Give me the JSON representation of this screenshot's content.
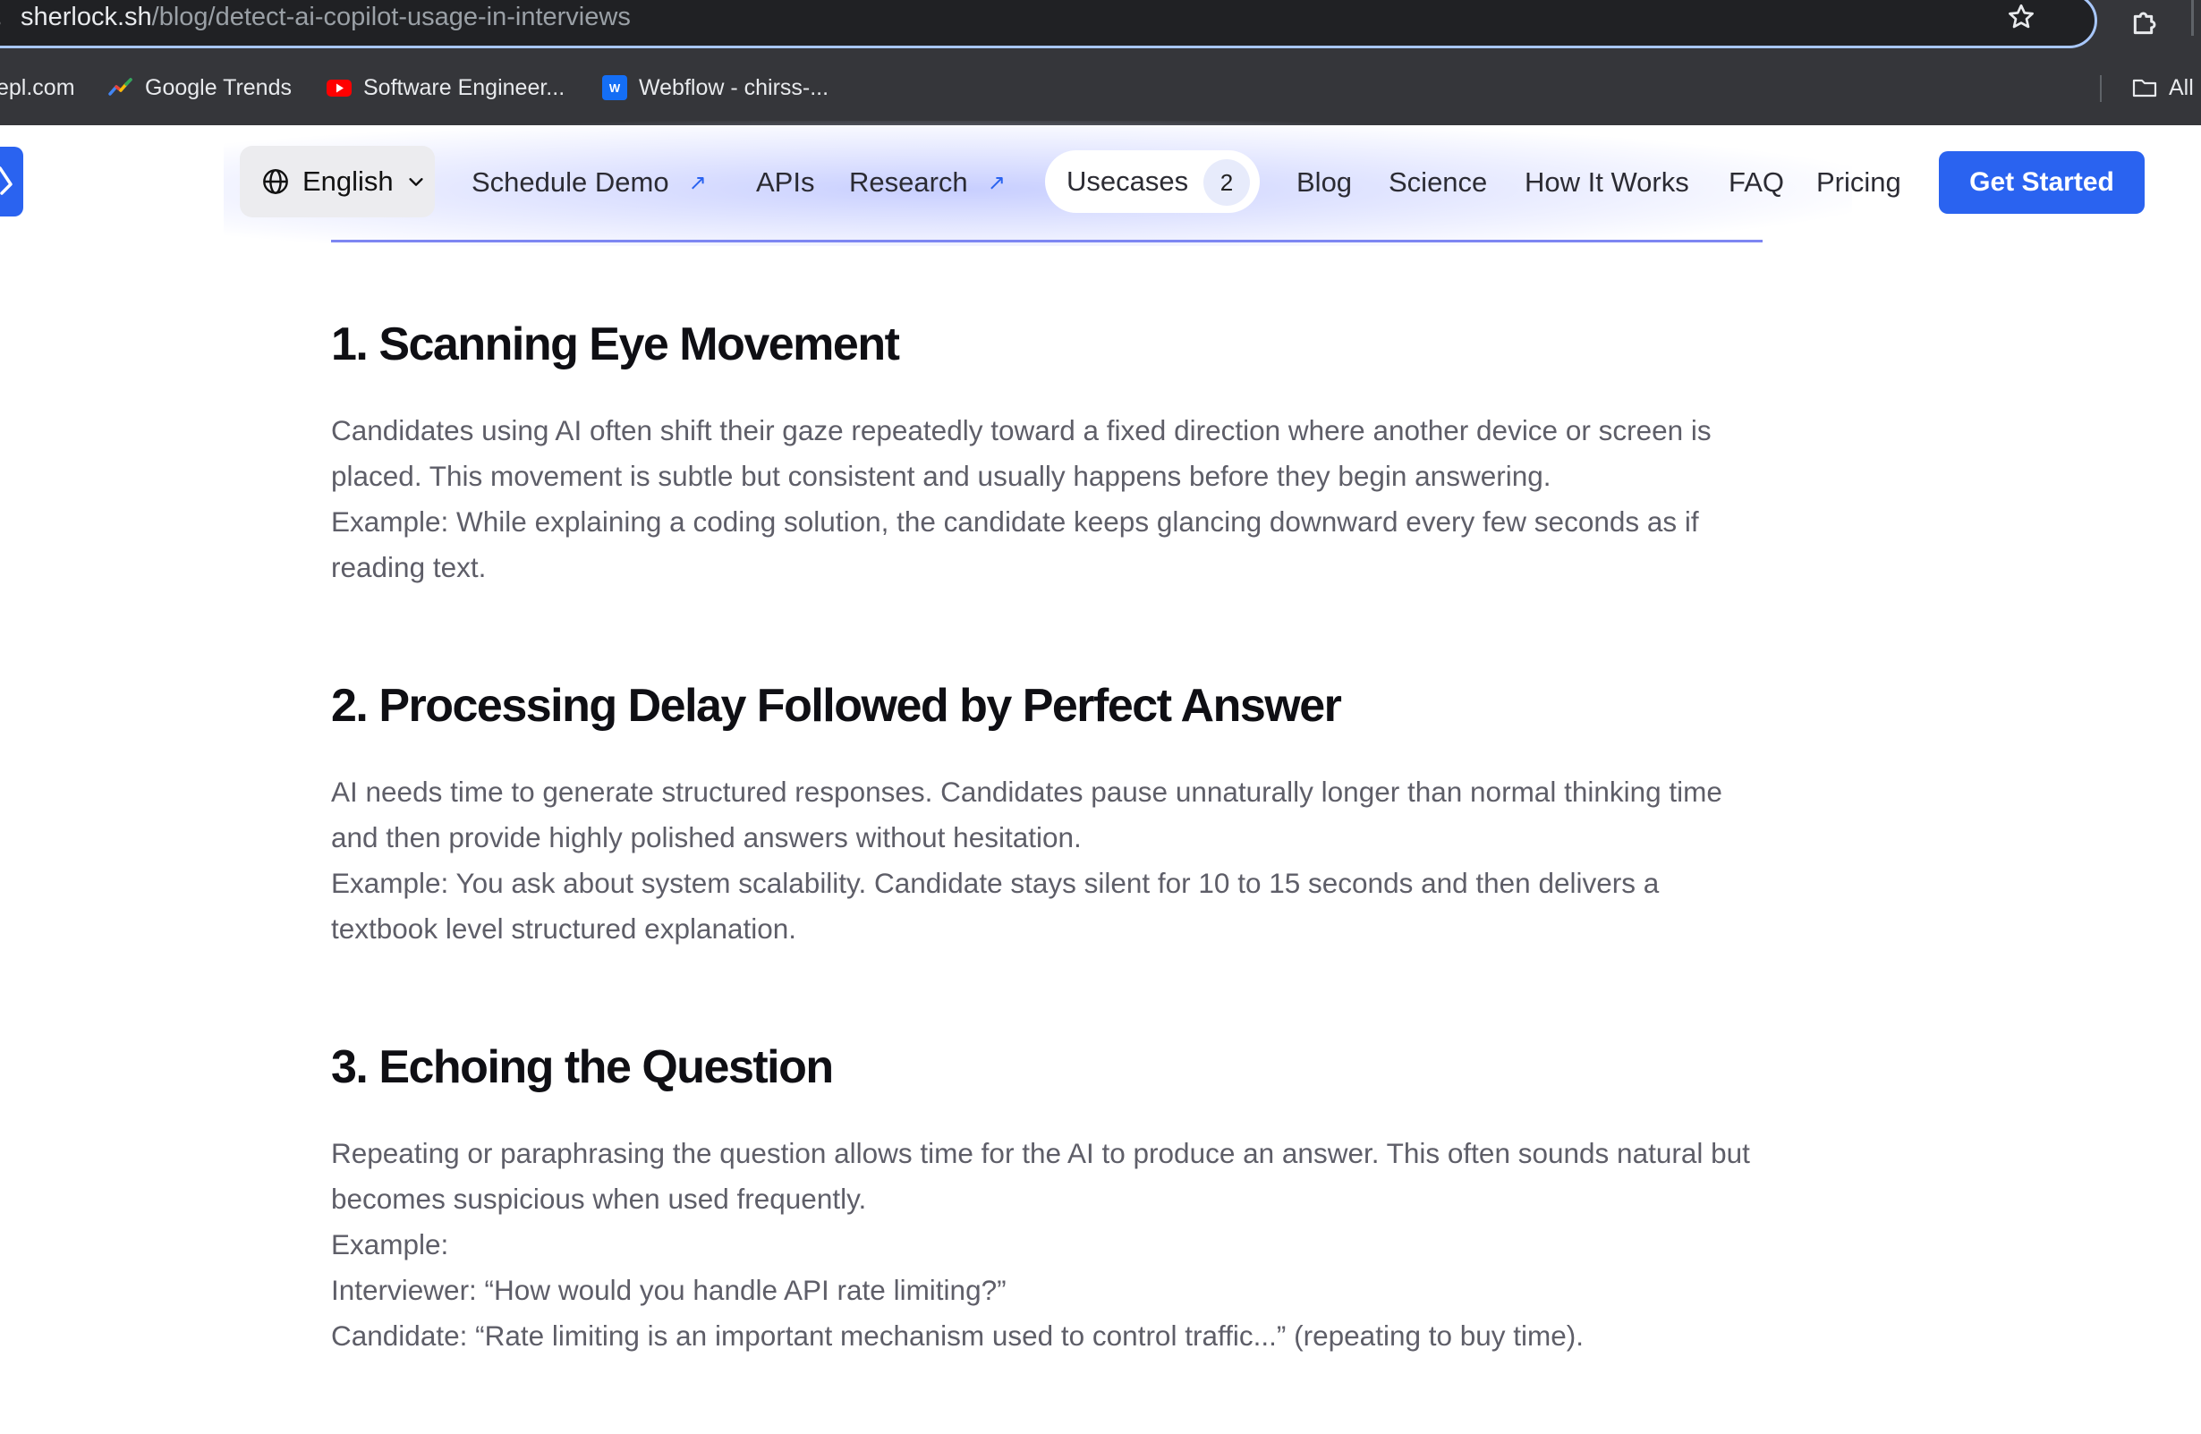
{
  "browser": {
    "url_host": "sherlock.sh",
    "url_path": "/blog/detect-ai-copilot-usage-in-interviews",
    "bookmarks": [
      {
        "label": "epl.com",
        "icon": "none"
      },
      {
        "label": "Google Trends",
        "icon": "google-trends-icon"
      },
      {
        "label": "Software Engineer...",
        "icon": "youtube-icon"
      },
      {
        "label": "Webflow - chirss-...",
        "icon": "webflow-icon"
      }
    ],
    "all_bookmarks_label": "All"
  },
  "nav": {
    "language": "English",
    "items": {
      "schedule_demo": "Schedule Demo",
      "apis": "APIs",
      "research": "Research",
      "usecases": "Usecases",
      "usecases_count": "2",
      "blog": "Blog",
      "science": "Science",
      "how_it_works": "How It Works",
      "faq": "FAQ",
      "pricing": "Pricing"
    },
    "cta": "Get Started",
    "external_arrow": "↗"
  },
  "article": {
    "sections": [
      {
        "heading": "1. Scanning Eye Movement",
        "lines": [
          "Candidates using AI often shift their gaze repeatedly toward a fixed direction where another device or screen is placed. This movement is subtle but consistent and usually happens before they begin answering.",
          "Example: While explaining a coding solution, the candidate keeps glancing downward every few seconds as if reading text."
        ]
      },
      {
        "heading": "2. Processing Delay Followed by Perfect Answer",
        "lines": [
          "AI needs time to generate structured responses. Candidates pause unnaturally longer than normal thinking time and then provide highly polished answers without hesitation.",
          "Example: You ask about system scalability. Candidate stays silent for 10 to 15 seconds and then delivers a textbook level structured explanation."
        ]
      },
      {
        "heading": "3. Echoing the Question",
        "lines": [
          "Repeating or paraphrasing the question allows time for the AI to produce an answer. This often sounds natural but becomes suspicious when used frequently.",
          "Example:",
          "Interviewer: “How would you handle API rate limiting?”",
          "Candidate: “Rate limiting is an important mechanism used to control traffic...” (repeating to buy time)."
        ]
      }
    ]
  },
  "colors": {
    "brand_blue": "#2a63f0",
    "chrome_bg": "#35363a",
    "heading": "#0f0f14",
    "body_text": "#5e5e68"
  }
}
